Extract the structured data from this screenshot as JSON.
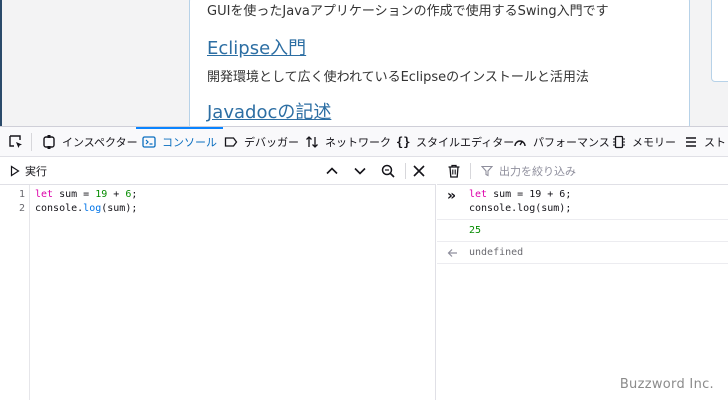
{
  "page": {
    "line1_desc": "GUIを使ったJavaアプリケーションの作成で使用するSwing入門です",
    "eclipse_title": "Eclipse入門",
    "eclipse_desc": "開発環境として広く使われているEclipseのインストールと活用法",
    "javadoc_title": "Javadocの記述"
  },
  "toolbar": {
    "tabs": [
      {
        "label": "インスペクター",
        "icon": "inspector-icon"
      },
      {
        "label": "コンソール",
        "icon": "console-icon"
      },
      {
        "label": "デバッガー",
        "icon": "debugger-icon"
      },
      {
        "label": "ネットワーク",
        "icon": "network-icon"
      },
      {
        "label": "スタイルエディター",
        "icon": "style-editor-icon"
      },
      {
        "label": "パフォーマンス",
        "icon": "performance-icon"
      },
      {
        "label": "メモリー",
        "icon": "memory-icon"
      },
      {
        "label": "スト",
        "icon": "storage-icon"
      }
    ],
    "active_tab": "コンソール"
  },
  "editor": {
    "run_label": "実行",
    "line_numbers": [
      "1",
      "2"
    ],
    "lines": [
      {
        "kw": "let",
        "rest1": " sum = ",
        "n1": "19",
        "op": " + ",
        "n2": "6",
        "end": ";"
      },
      {
        "obj": "console.",
        "fn": "log",
        "args": "(sum);"
      }
    ]
  },
  "output": {
    "filter_placeholder": "出力を絞り込み",
    "input_echo_line1_kw": "let",
    "input_echo_line1_rest": " sum = 19 + 6;",
    "input_echo_line2": "console.log(sum);",
    "log_value": "25",
    "return_value": "undefined"
  },
  "watermark": "Buzzword Inc.",
  "colors": {
    "accent": "#0a84ff",
    "keyword": "#dd00a9",
    "number": "#058b00",
    "function": "#0074e8",
    "link": "#2c6ea3"
  }
}
